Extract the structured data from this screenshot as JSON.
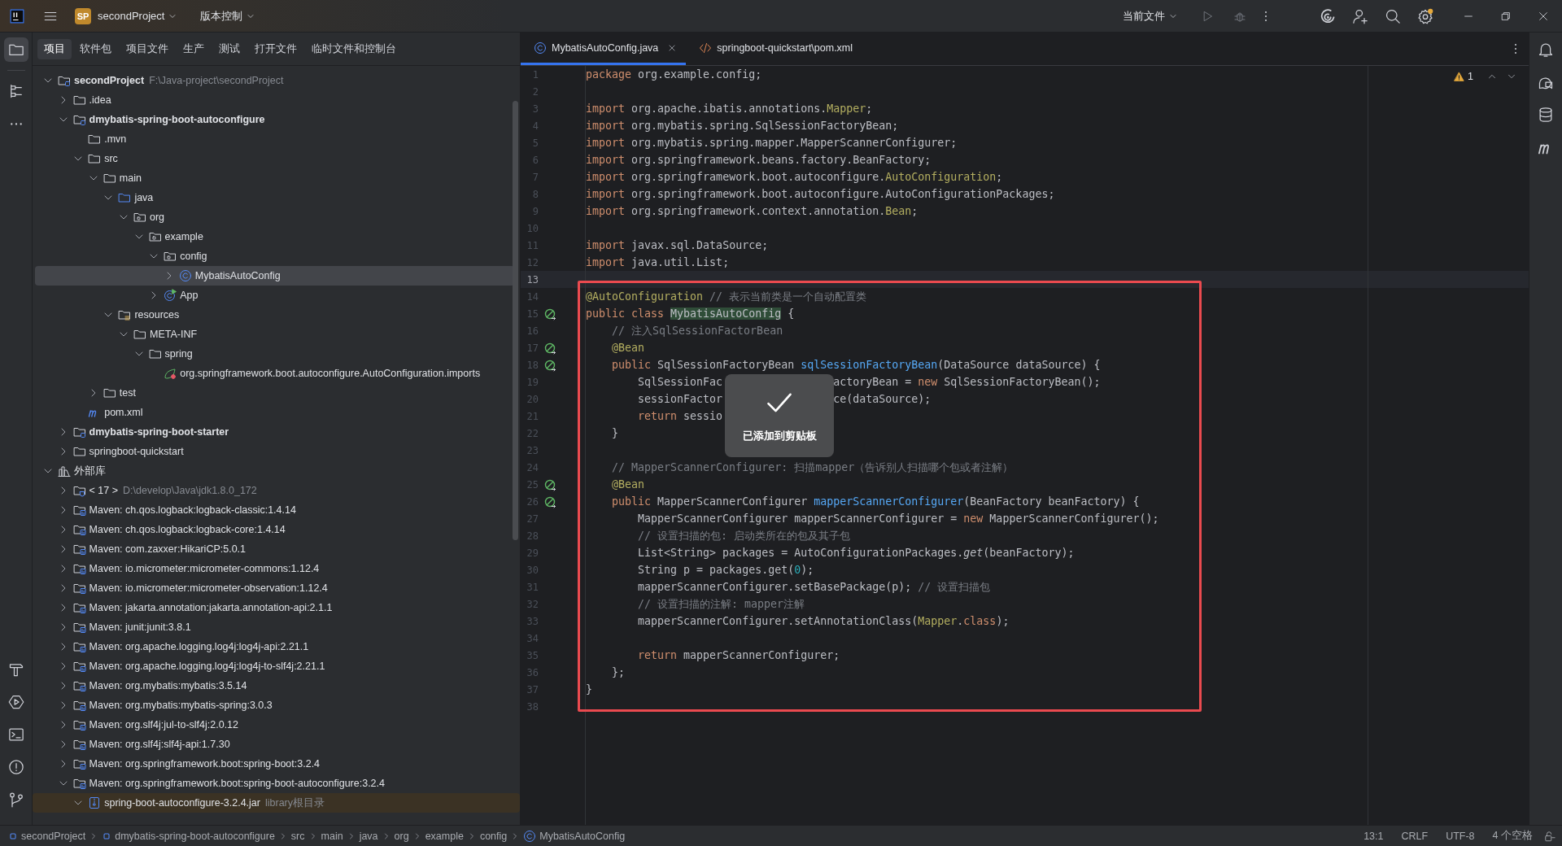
{
  "titlebar": {
    "project_badge": "SP",
    "project": "secondProject",
    "vcs": "版本控制",
    "run_config": "当前文件"
  },
  "left_tools": [
    {
      "kind": "project",
      "selected": true
    },
    {
      "kind": "structure",
      "selected": false
    },
    {
      "kind": "more",
      "selected": false
    }
  ],
  "left_tools_bottom": [
    {
      "kind": "build",
      "selected": false
    },
    {
      "kind": "run",
      "selected": false
    },
    {
      "kind": "terminal",
      "selected": false
    },
    {
      "kind": "problems",
      "selected": false
    },
    {
      "kind": "git",
      "selected": false
    }
  ],
  "panel_tabs": [
    {
      "label": "项目",
      "selected": true
    },
    {
      "label": "软件包",
      "selected": false
    },
    {
      "label": "项目文件",
      "selected": false
    },
    {
      "label": "生产",
      "selected": false
    },
    {
      "label": "测试",
      "selected": false
    },
    {
      "label": "打开文件",
      "selected": false
    },
    {
      "label": "临时文件和控制台",
      "selected": false
    }
  ],
  "tree": [
    {
      "label": "secondProject",
      "path": "F:\\Java-project\\secondProject",
      "kind": "module",
      "expanded": true,
      "selected": false,
      "children": [
        {
          "label": ".idea",
          "kind": "folder",
          "expanded": false,
          "selected": false
        },
        {
          "label": "dmybatis-spring-boot-autoconfigure",
          "kind": "module",
          "expanded": true,
          "selected": false,
          "children": [
            {
              "label": ".mvn",
              "kind": "folder",
              "selected": false
            },
            {
              "label": "src",
              "kind": "folder",
              "expanded": true,
              "selected": false,
              "children": [
                {
                  "label": "main",
                  "kind": "folder",
                  "expanded": true,
                  "selected": false,
                  "children": [
                    {
                      "label": "java",
                      "kind": "source",
                      "expanded": true,
                      "selected": false,
                      "children": [
                        {
                          "label": "org",
                          "kind": "package",
                          "expanded": true,
                          "selected": false,
                          "children": [
                            {
                              "label": "example",
                              "kind": "package",
                              "expanded": true,
                              "selected": false,
                              "children": [
                                {
                                  "label": "config",
                                  "kind": "package",
                                  "expanded": true,
                                  "selected": false,
                                  "children": [
                                    {
                                      "label": "MybatisAutoConfig",
                                      "kind": "class",
                                      "expanded": false,
                                      "selected": true
                                    }
                                  ]
                                },
                                {
                                  "label": "App",
                                  "kind": "application",
                                  "expanded": false,
                                  "selected": false
                                }
                              ]
                            }
                          ]
                        }
                      ]
                    },
                    {
                      "label": "resources",
                      "kind": "resources",
                      "expanded": true,
                      "selected": false,
                      "children": [
                        {
                          "label": "META-INF",
                          "kind": "folder",
                          "expanded": true,
                          "selected": false,
                          "children": [
                            {
                              "label": "spring",
                              "kind": "folder",
                              "expanded": true,
                              "selected": false,
                              "children": [
                                {
                                  "label": "org.springframework.boot.autoconfigure.AutoConfiguration.imports",
                                  "kind": "spring",
                                  "selected": false
                                }
                              ]
                            }
                          ]
                        }
                      ]
                    }
                  ]
                },
                {
                  "label": "test",
                  "kind": "folder",
                  "expanded": false,
                  "selected": false
                }
              ]
            },
            {
              "label": "pom.xml",
              "kind": "pom",
              "selected": false
            }
          ]
        },
        {
          "label": "dmybatis-spring-boot-starter",
          "kind": "module",
          "expanded": false,
          "selected": false
        },
        {
          "label": "springboot-quickstart",
          "kind": "folder",
          "expanded": false,
          "selected": false
        }
      ]
    },
    {
      "label": "外部库",
      "kind": "libraries",
      "expanded": true,
      "selected": false,
      "children": [
        {
          "label": "< 17 >",
          "path": "D:\\develop\\Java\\jdk1.8.0_172",
          "kind": "jdk",
          "expanded": false,
          "selected": false
        },
        {
          "label": "Maven: ch.qos.logback:logback-classic:1.4.14",
          "kind": "library",
          "expanded": false,
          "selected": false
        },
        {
          "label": "Maven: ch.qos.logback:logback-core:1.4.14",
          "kind": "library",
          "expanded": false,
          "selected": false
        },
        {
          "label": "Maven: com.zaxxer:HikariCP:5.0.1",
          "kind": "library",
          "expanded": false,
          "selected": false
        },
        {
          "label": "Maven: io.micrometer:micrometer-commons:1.12.4",
          "kind": "library",
          "expanded": false,
          "selected": false
        },
        {
          "label": "Maven: io.micrometer:micrometer-observation:1.12.4",
          "kind": "library",
          "expanded": false,
          "selected": false
        },
        {
          "label": "Maven: jakarta.annotation:jakarta.annotation-api:2.1.1",
          "kind": "library",
          "expanded": false,
          "selected": false
        },
        {
          "label": "Maven: junit:junit:3.8.1",
          "kind": "library",
          "expanded": false,
          "selected": false
        },
        {
          "label": "Maven: org.apache.logging.log4j:log4j-api:2.21.1",
          "kind": "library",
          "expanded": false,
          "selected": false
        },
        {
          "label": "Maven: org.apache.logging.log4j:log4j-to-slf4j:2.21.1",
          "kind": "library",
          "expanded": false,
          "selected": false
        },
        {
          "label": "Maven: org.mybatis:mybatis:3.5.14",
          "kind": "library",
          "expanded": false,
          "selected": false
        },
        {
          "label": "Maven: org.mybatis:mybatis-spring:3.0.3",
          "kind": "library",
          "expanded": false,
          "selected": false
        },
        {
          "label": "Maven: org.slf4j:jul-to-slf4j:2.0.12",
          "kind": "library",
          "expanded": false,
          "selected": false
        },
        {
          "label": "Maven: org.slf4j:slf4j-api:1.7.30",
          "kind": "library",
          "expanded": false,
          "selected": false
        },
        {
          "label": "Maven: org.springframework.boot:spring-boot:3.2.4",
          "kind": "library",
          "expanded": false,
          "selected": false
        },
        {
          "label": "Maven: org.springframework.boot:spring-boot-autoconfigure:3.2.4",
          "kind": "library",
          "expanded": true,
          "selected": false,
          "children": [
            {
              "label": "spring-boot-autoconfigure-3.2.4.jar",
              "path": "library根目录",
              "kind": "jar",
              "expanded": true,
              "selected": false,
              "highlighted": true
            }
          ]
        }
      ]
    }
  ],
  "editor_tabs": [
    {
      "label": "MybatisAutoConfig.java",
      "kind": "class",
      "selected": true
    },
    {
      "label": "springboot-quickstart\\pom.xml",
      "kind": "xml",
      "selected": false
    }
  ],
  "warnings": "1",
  "code": [
    {
      "n": "1",
      "tokens": [
        {
          "kind": "kw",
          "text": "package"
        },
        {
          "kind": "tx",
          "text": " org.example.config;"
        }
      ]
    },
    {
      "n": "2"
    },
    {
      "n": "3",
      "tokens": [
        {
          "kind": "kw",
          "text": "import"
        },
        {
          "kind": "tx",
          "text": " org.apache.ibatis.annotations."
        },
        {
          "kind": "an",
          "text": "Mapper"
        },
        {
          "kind": "tx",
          "text": ";"
        }
      ]
    },
    {
      "n": "4",
      "tokens": [
        {
          "kind": "kw",
          "text": "import"
        },
        {
          "kind": "tx",
          "text": " org.mybatis.spring.SqlSessionFactoryBean;"
        }
      ]
    },
    {
      "n": "5",
      "tokens": [
        {
          "kind": "kw",
          "text": "import"
        },
        {
          "kind": "tx",
          "text": " org.mybatis.spring.mapper.MapperScannerConfigurer;"
        }
      ]
    },
    {
      "n": "6",
      "tokens": [
        {
          "kind": "kw",
          "text": "import"
        },
        {
          "kind": "tx",
          "text": " org.springframework.beans.factory.BeanFactory;"
        }
      ]
    },
    {
      "n": "7",
      "tokens": [
        {
          "kind": "kw",
          "text": "import"
        },
        {
          "kind": "tx",
          "text": " org.springframework.boot.autoconfigure."
        },
        {
          "kind": "an",
          "text": "AutoConfiguration"
        },
        {
          "kind": "tx",
          "text": ";"
        }
      ]
    },
    {
      "n": "8",
      "tokens": [
        {
          "kind": "kw",
          "text": "import"
        },
        {
          "kind": "tx",
          "text": " org.springframework.boot.autoconfigure.AutoConfigurationPackages;"
        }
      ]
    },
    {
      "n": "9",
      "tokens": [
        {
          "kind": "kw",
          "text": "import"
        },
        {
          "kind": "tx",
          "text": " org.springframework.context.annotation."
        },
        {
          "kind": "an",
          "text": "Bean"
        },
        {
          "kind": "tx",
          "text": ";"
        }
      ]
    },
    {
      "n": "10"
    },
    {
      "n": "11",
      "tokens": [
        {
          "kind": "kw",
          "text": "import"
        },
        {
          "kind": "tx",
          "text": " javax.sql.DataSource;"
        }
      ]
    },
    {
      "n": "12",
      "tokens": [
        {
          "kind": "kw",
          "text": "import"
        },
        {
          "kind": "tx",
          "text": " java.util.List;"
        }
      ]
    },
    {
      "n": "13",
      "current": true
    },
    {
      "n": "14",
      "tokens": [
        {
          "kind": "an",
          "text": "@AutoConfiguration"
        },
        {
          "kind": "cm",
          "text": " // 表示当前类是一个自动配置类"
        }
      ]
    },
    {
      "n": "15",
      "kind": "bean",
      "tokens": [
        {
          "kind": "kw",
          "text": "public class "
        },
        {
          "kind": "hl",
          "text": "MybatisAutoConfig"
        },
        {
          "kind": "tx",
          "text": " {"
        }
      ]
    },
    {
      "n": "16",
      "tokens": [
        {
          "kind": "cm",
          "text": "    // 注入SqlSessionFactorBean"
        }
      ]
    },
    {
      "n": "17",
      "kind": "bean",
      "tokens": [
        {
          "kind": "an",
          "text": "    @Bean"
        }
      ]
    },
    {
      "n": "18",
      "kind": "bean",
      "tokens": [
        {
          "kind": "kw",
          "text": "    public"
        },
        {
          "kind": "tx",
          "text": " SqlSessionFactoryBean "
        },
        {
          "kind": "fn",
          "text": "sqlSessionFactoryBean"
        },
        {
          "kind": "tx",
          "text": "(DataSource dataSource) {"
        }
      ]
    },
    {
      "n": "19",
      "tokens": [
        {
          "kind": "tx",
          "text": "        SqlSessionFac"
        },
        {
          "kind": "gap"
        },
        {
          "kind": "tx",
          "text": "actoryBean = "
        },
        {
          "kind": "kw",
          "text": "new"
        },
        {
          "kind": "tx",
          "text": " SqlSessionFactoryBean();"
        }
      ]
    },
    {
      "n": "20",
      "tokens": [
        {
          "kind": "tx",
          "text": "        sessionFactor"
        },
        {
          "kind": "gap"
        },
        {
          "kind": "tx",
          "text": "ce(dataSource);"
        }
      ]
    },
    {
      "n": "21",
      "tokens": [
        {
          "kind": "kw",
          "text": "        return"
        },
        {
          "kind": "tx",
          "text": " sessio"
        }
      ]
    },
    {
      "n": "22",
      "tokens": [
        {
          "kind": "tx",
          "text": "    }"
        }
      ]
    },
    {
      "n": "23"
    },
    {
      "n": "24",
      "tokens": [
        {
          "kind": "cm",
          "text": "    // MapperScannerConfigurer: 扫描mapper（告诉别人扫描哪个包或者注解）"
        }
      ]
    },
    {
      "n": "25",
      "kind": "bean",
      "tokens": [
        {
          "kind": "an",
          "text": "    @Bean"
        }
      ]
    },
    {
      "n": "26",
      "kind": "bean",
      "tokens": [
        {
          "kind": "kw",
          "text": "    public"
        },
        {
          "kind": "tx",
          "text": " MapperScannerConfigurer "
        },
        {
          "kind": "fn",
          "text": "mapperScannerConfigurer"
        },
        {
          "kind": "tx",
          "text": "(BeanFactory beanFactory) {"
        }
      ]
    },
    {
      "n": "27",
      "tokens": [
        {
          "kind": "tx",
          "text": "        MapperScannerConfigurer mapperScannerConfigurer = "
        },
        {
          "kind": "kw",
          "text": "new"
        },
        {
          "kind": "tx",
          "text": " MapperScannerConfigurer();"
        }
      ]
    },
    {
      "n": "28",
      "tokens": [
        {
          "kind": "cm",
          "text": "        // 设置扫描的包: 启动类所在的包及其子包"
        }
      ]
    },
    {
      "n": "29",
      "tokens": [
        {
          "kind": "tx",
          "text": "        List<String> packages = AutoConfigurationPackages."
        },
        {
          "kind": "it",
          "text": "get"
        },
        {
          "kind": "tx",
          "text": "(beanFactory);"
        }
      ]
    },
    {
      "n": "30",
      "tokens": [
        {
          "kind": "tx",
          "text": "        String p = packages.get("
        },
        {
          "kind": "num",
          "text": "0"
        },
        {
          "kind": "tx",
          "text": ");"
        }
      ]
    },
    {
      "n": "31",
      "tokens": [
        {
          "kind": "tx",
          "text": "        mapperScannerConfigurer.setBasePackage(p); "
        },
        {
          "kind": "cm",
          "text": "// 设置扫描包"
        }
      ]
    },
    {
      "n": "32",
      "tokens": [
        {
          "kind": "cm",
          "text": "        // 设置扫描的注解: mapper注解"
        }
      ]
    },
    {
      "n": "33",
      "tokens": [
        {
          "kind": "tx",
          "text": "        mapperScannerConfigurer.setAnnotationClass("
        },
        {
          "kind": "an",
          "text": "Mapper"
        },
        {
          "kind": "tx",
          "text": "."
        },
        {
          "kind": "kw",
          "text": "class"
        },
        {
          "kind": "tx",
          "text": ");"
        }
      ]
    },
    {
      "n": "34"
    },
    {
      "n": "35",
      "tokens": [
        {
          "kind": "kw",
          "text": "        return"
        },
        {
          "kind": "tx",
          "text": " mapperScannerConfigurer;"
        }
      ]
    },
    {
      "n": "36",
      "tokens": [
        {
          "kind": "tx",
          "text": "    };"
        }
      ]
    },
    {
      "n": "37",
      "tokens": [
        {
          "kind": "tx",
          "text": "}"
        }
      ]
    },
    {
      "n": "38"
    }
  ],
  "toast": {
    "message": "已添加到剪贴板"
  },
  "right_tools": [
    {
      "kind": "notifications"
    },
    {
      "kind": "chat"
    },
    {
      "kind": "database"
    },
    {
      "kind": "maven"
    }
  ],
  "breadcrumb": [
    {
      "label": "secondProject",
      "kind": "module"
    },
    {
      "label": "dmybatis-spring-boot-autoconfigure",
      "kind": "module"
    },
    {
      "label": "src"
    },
    {
      "label": "main"
    },
    {
      "label": "java"
    },
    {
      "label": "org"
    },
    {
      "label": "example"
    },
    {
      "label": "config"
    },
    {
      "label": "MybatisAutoConfig",
      "kind": "class"
    }
  ],
  "status_items": [
    "13:1",
    "CRLF",
    "UTF-8",
    "4 个空格"
  ]
}
